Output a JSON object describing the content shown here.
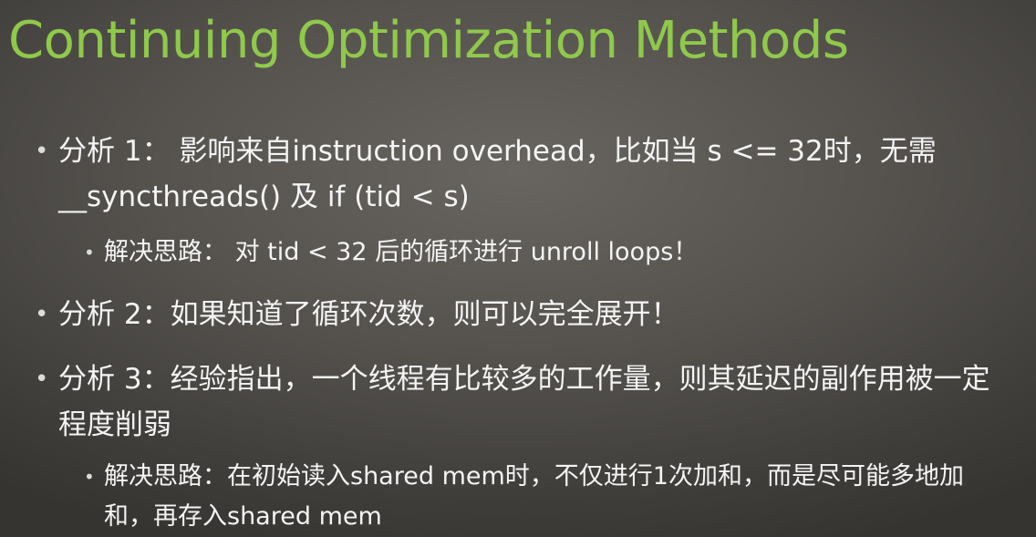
{
  "slide": {
    "title": "Continuing Optimization Methods",
    "bullet_glyph": "•",
    "bullets": [
      {
        "text": "分析 1： 影响来自instruction overhead，比如当 s <= 32时，无需__syncthreads() 及 if (tid < s)",
        "sub": "解决思路： 对 tid < 32 后的循环进行 unroll loops！"
      },
      {
        "text": "分析 2：如果知道了循环次数，则可以完全展开！"
      },
      {
        "text": "分析 3：经验指出，一个线程有比较多的工作量，则其延迟的副作用被一定程度削弱",
        "sub": "解决思路：在初始读入shared mem时，不仅进行1次加和，而是尽可能多地加和，再存入shared mem"
      }
    ]
  },
  "colors": {
    "title": "#8fc94a",
    "text": "#f4f4f4",
    "background": "#55524e"
  }
}
